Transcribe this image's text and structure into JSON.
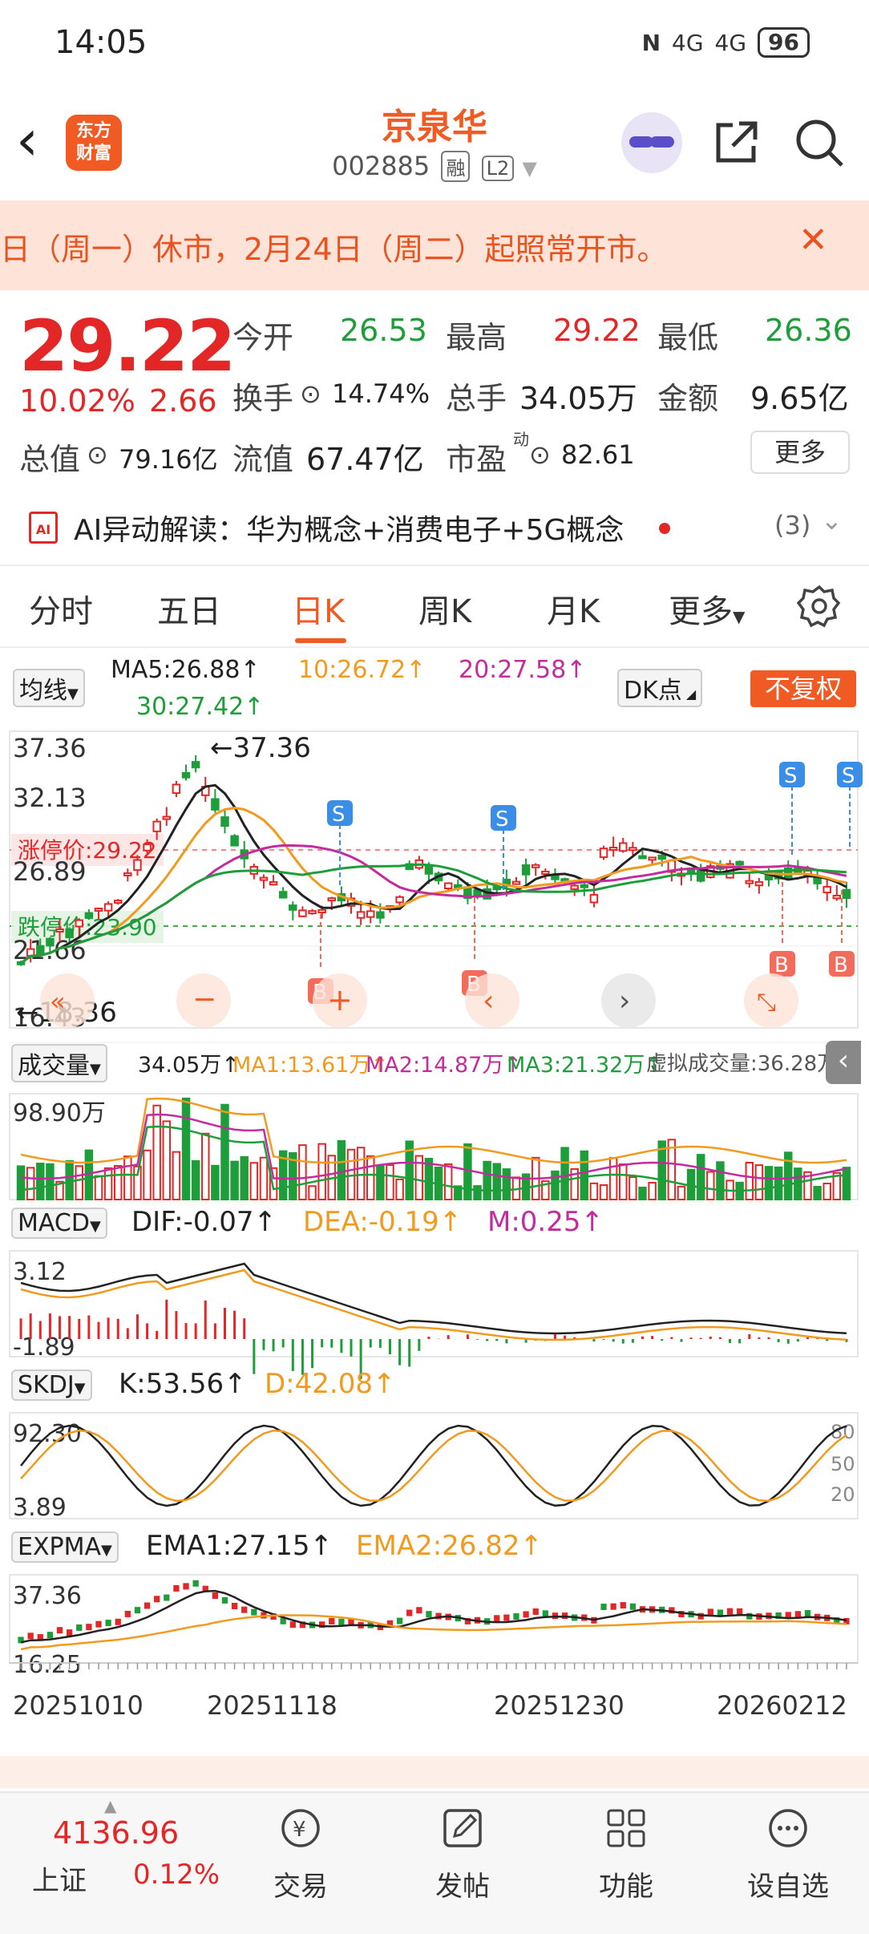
{
  "status_bar": {
    "time": "14:05",
    "nfc": "N",
    "signal1": "4G",
    "signal2": "4G",
    "battery": "96"
  },
  "header": {
    "logo_line1": "东方",
    "logo_line2": "财富",
    "stock_name": "京泉华",
    "stock_code": "002885",
    "tag_margin": "融",
    "tag_level": "L2"
  },
  "notice": {
    "text": "日（周一）休市，2月24日（周二）起照常开市。"
  },
  "quote": {
    "price": "29.22",
    "change_pct": "10.02%",
    "change": "2.66",
    "open_label": "今开",
    "open": "26.53",
    "high_label": "最高",
    "high": "29.22",
    "low_label": "最低",
    "low": "26.36",
    "turnover_label": "换手",
    "turnover": "14.74%",
    "volume_label": "总手",
    "volume": "34.05万",
    "amount_label": "金额",
    "amount": "9.65亿",
    "mktcap_label": "总值",
    "mktcap": "79.16亿",
    "float_label": "流值",
    "float": "67.47亿",
    "pe_label": "市盈",
    "pe_sup": "动",
    "pe": "82.61",
    "more_label": "更多"
  },
  "ai": {
    "icon_text": "AI",
    "text": "AI异动解读：华为概念+消费电子+5G概念",
    "count": "(3)"
  },
  "tabs": [
    "分时",
    "五日",
    "日K",
    "周K",
    "月K",
    "更多"
  ],
  "chart": {
    "ma_selector": "均线",
    "ma5": "MA5:26.88↑",
    "ma10": "10:26.72↑",
    "ma20": "20:27.58↑",
    "ma30": "30:27.42↑",
    "dk_label": "DK点",
    "fq_label": "不复权",
    "y_labels": [
      "37.36",
      "32.13",
      "26.89",
      "21.66",
      "16.43"
    ],
    "limit_up_label": "涨停价:29.22",
    "limit_down_label": "跌停价:23.90",
    "high_marker": "←37.36",
    "low_marker": "←18.36",
    "signal_s": "S",
    "signal_b": "B",
    "vol_selector": "成交量",
    "vol_line": "34.05万↑",
    "vol_ma1": "MA1:13.61万↑",
    "vol_ma2": "MA2:14.87万↑",
    "vol_ma3": "MA3:21.32万↑",
    "vol_virtual": "虚拟成交量:36.28万",
    "vol_max": "98.90万",
    "macd_selector": "MACD",
    "macd_dif": "DIF:-0.07↑",
    "macd_dea": "DEA:-0.19↑",
    "macd_m": "M:0.25↑",
    "macd_top": "3.12",
    "macd_bottom": "-1.89",
    "skdj_selector": "SKDJ",
    "skdj_k": "K:53.56↑",
    "skdj_d": "D:42.08↑",
    "skdj_top": "92.30",
    "skdj_bottom": "3.89",
    "skdj_levels": [
      "80",
      "50",
      "20"
    ],
    "expma_selector": "EXPMA",
    "expma1": "EMA1:27.15↑",
    "expma2": "EMA2:26.82↑",
    "expma_top": "37.36",
    "expma_bottom": "16.25",
    "dates": [
      "20251010",
      "20251118",
      "20251230",
      "20260212"
    ]
  },
  "bottom": {
    "index_value": "4136.96",
    "index_name": "上证",
    "index_pct": "0.12%",
    "items": [
      "交易",
      "发帖",
      "功能",
      "设自选"
    ]
  },
  "colors": {
    "accent": "#f05a23",
    "up": "#e32626",
    "down": "#1e9e3a"
  }
}
